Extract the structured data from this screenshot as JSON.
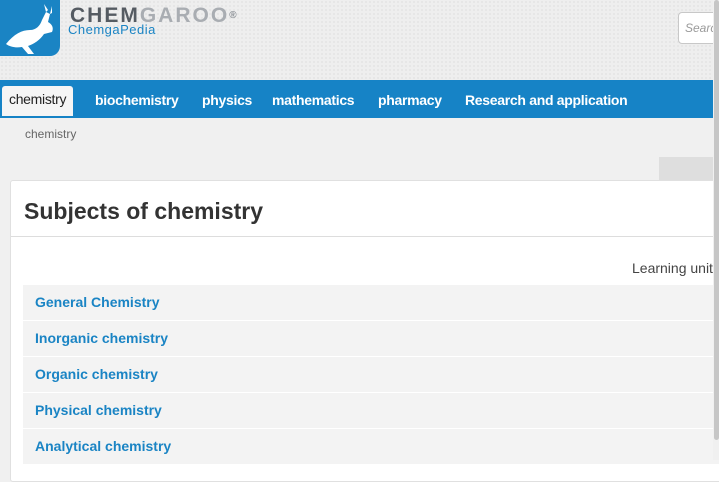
{
  "header": {
    "brand_part1": "CHEM",
    "brand_part2": "GAROO",
    "brand_reg": "®",
    "brand_sub": "ChemgaPedia",
    "search_placeholder": "Search"
  },
  "nav": {
    "tabs": [
      {
        "label": "chemistry",
        "active": true
      },
      {
        "label": "biochemistry",
        "active": false
      },
      {
        "label": "physics",
        "active": false
      },
      {
        "label": "mathematics",
        "active": false
      },
      {
        "label": "pharmacy",
        "active": false
      },
      {
        "label": "Research and application",
        "active": false
      }
    ]
  },
  "breadcrumb": "chemistry",
  "main": {
    "title": "Subjects of chemistry",
    "column_header": "Learning units",
    "subjects": [
      "General Chemistry",
      "Inorganic chemistry",
      "Organic chemistry",
      "Physical chemistry",
      "Analytical chemistry"
    ]
  },
  "colors": {
    "accent": "#1683c6",
    "link": "#1a84c4"
  },
  "icons": {
    "logo": "kangaroo-logo-icon"
  }
}
